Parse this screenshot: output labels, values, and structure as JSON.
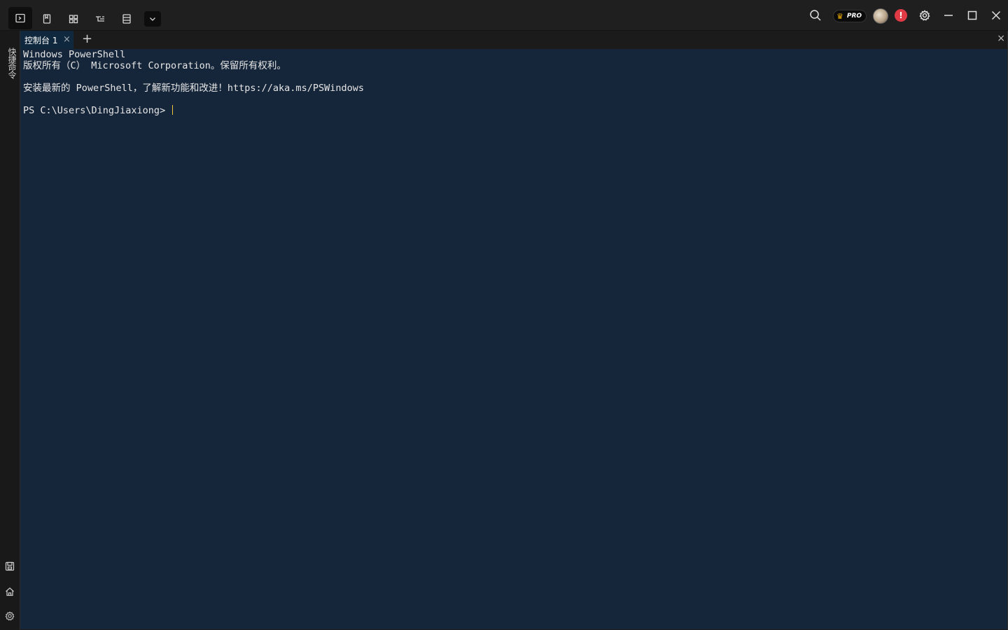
{
  "toolbar": {
    "icons": [
      "terminal-icon",
      "bookmark-icon",
      "layout-icon",
      "tree-icon",
      "list-icon",
      "chevron-down-icon"
    ]
  },
  "header_right": {
    "pro_label": "PRO"
  },
  "sidebar": {
    "vertical_label": "快捷命令",
    "bottom_icons": [
      "save-icon",
      "home-icon",
      "gear-icon"
    ]
  },
  "tabs": [
    {
      "label": "控制台 1",
      "close": "×"
    }
  ],
  "tab_add": "+",
  "pane_close": "×",
  "terminal": {
    "lines": [
      "Windows PowerShell",
      "版权所有（C） Microsoft Corporation。保留所有权利。",
      "",
      "安装最新的 PowerShell，了解新功能和改进！https://aka.ms/PSWindows",
      "",
      "PS C:\\Users\\DingJiaxiong> "
    ]
  },
  "colors": {
    "terminal_bg": "#16263a",
    "tab_active_bg": "#10283d",
    "cursor": "#f5c542",
    "alert": "#e03a45",
    "crown": "#f5b400"
  }
}
